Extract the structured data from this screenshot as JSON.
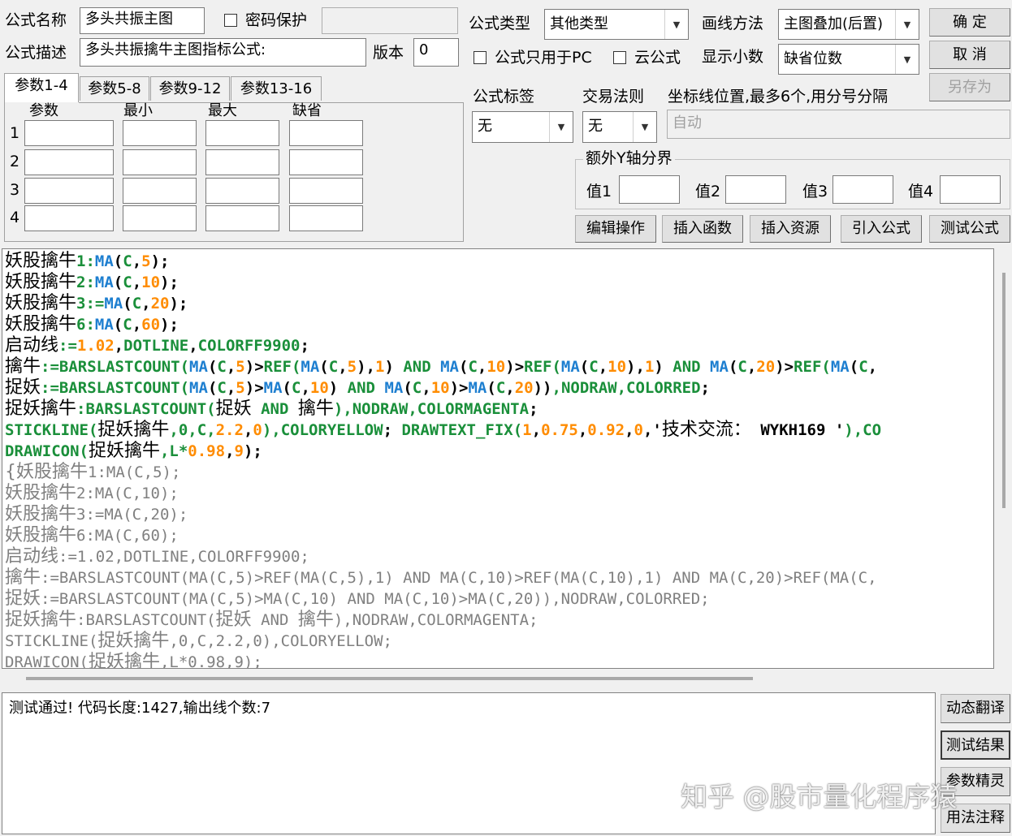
{
  "header": {
    "name_label": "公式名称",
    "name_value": "多头共振主图",
    "password_label": "密码保护",
    "desc_label": "公式描述",
    "desc_value": "多头共振擒牛主图指标公式:",
    "version_label": "版本",
    "version_value": "0",
    "type_label": "公式类型",
    "type_value": "其他类型",
    "draw_label": "画线方法",
    "draw_value": "主图叠加(后置)",
    "pc_only_label": "公式只用于PC",
    "cloud_label": "云公式",
    "decimal_label": "显示小数",
    "decimal_value": "缺省位数"
  },
  "buttons": {
    "ok": "确  定",
    "cancel": "取  消",
    "save_as": "另存为",
    "edit_ops": "编辑操作",
    "insert_func": "插入函数",
    "insert_res": "插入资源",
    "import_formula": "引入公式",
    "test_formula": "测试公式",
    "dyn_translate": "动态翻译",
    "test_result": "测试结果",
    "param_wizard": "参数精灵",
    "usage_note": "用法注释"
  },
  "tabs": [
    "参数1-4",
    "参数5-8",
    "参数9-12",
    "参数13-16"
  ],
  "params": {
    "col_headers": [
      "参数",
      "最小",
      "最大",
      "缺省"
    ],
    "rows": [
      "1",
      "2",
      "3",
      "4"
    ]
  },
  "right_panel": {
    "tag_label": "公式标签",
    "tag_value": "无",
    "rule_label": "交易法则",
    "rule_value": "无",
    "coord_label": "坐标线位置,最多6个,用分号分隔",
    "coord_value": "自动",
    "yaxis_group": "额外Y轴分界",
    "val1": "值1",
    "val2": "值2",
    "val3": "值3",
    "val4": "值4"
  },
  "output": {
    "message": "测试通过! 代码长度:1427,输出线个数:7"
  },
  "watermark": "知乎 @股市量化程序猿",
  "colors": {
    "keyword": "#1a8f3a",
    "function": "#1e7fd0",
    "number": "#ff8c00",
    "comment": "#808080"
  },
  "code_lines": [
    [
      [
        "vn",
        "妖股擒牛"
      ],
      [
        "kw",
        "1:"
      ],
      [
        "fn",
        "MA"
      ],
      [
        "",
        "("
      ],
      [
        "kw",
        "C"
      ],
      [
        "",
        ","
      ],
      [
        "num",
        "5"
      ],
      [
        "",
        ");"
      ]
    ],
    [
      [
        "vn",
        "妖股擒牛"
      ],
      [
        "kw",
        "2:"
      ],
      [
        "fn",
        "MA"
      ],
      [
        "",
        "("
      ],
      [
        "kw",
        "C"
      ],
      [
        "",
        ","
      ],
      [
        "num",
        "10"
      ],
      [
        "",
        ");"
      ]
    ],
    [
      [
        "vn",
        "妖股擒牛"
      ],
      [
        "kw",
        "3:="
      ],
      [
        "fn",
        "MA"
      ],
      [
        "",
        "("
      ],
      [
        "kw",
        "C"
      ],
      [
        "",
        ","
      ],
      [
        "num",
        "20"
      ],
      [
        "",
        ");"
      ]
    ],
    [
      [
        "vn",
        "妖股擒牛"
      ],
      [
        "kw",
        "6:"
      ],
      [
        "fn",
        "MA"
      ],
      [
        "",
        "("
      ],
      [
        "kw",
        "C"
      ],
      [
        "",
        ","
      ],
      [
        "num",
        "60"
      ],
      [
        "",
        ");"
      ]
    ],
    [
      [
        "vn",
        "启动线"
      ],
      [
        "kw",
        ":="
      ],
      [
        "num",
        "1.02"
      ],
      [
        "",
        ","
      ],
      [
        "kw",
        "DOTLINE"
      ],
      [
        "",
        ","
      ],
      [
        "kw",
        "COLORFF9900"
      ],
      [
        "",
        ";"
      ]
    ],
    [
      [
        "vn",
        "擒牛"
      ],
      [
        "kw",
        ":=BARSLASTCOUNT("
      ],
      [
        "fn",
        "MA"
      ],
      [
        "",
        "("
      ],
      [
        "kw",
        "C"
      ],
      [
        "",
        ","
      ],
      [
        "num",
        "5"
      ],
      [
        "",
        ")>"
      ],
      [
        "kw",
        "REF("
      ],
      [
        "fn",
        "MA"
      ],
      [
        "",
        "("
      ],
      [
        "kw",
        "C"
      ],
      [
        "",
        ","
      ],
      [
        "num",
        "5"
      ],
      [
        "",
        "),"
      ],
      [
        "num",
        "1"
      ],
      [
        "",
        ") "
      ],
      [
        "kw",
        "AND "
      ],
      [
        "fn",
        "MA"
      ],
      [
        "",
        "("
      ],
      [
        "kw",
        "C"
      ],
      [
        "",
        ","
      ],
      [
        "num",
        "10"
      ],
      [
        "",
        ")>"
      ],
      [
        "kw",
        "REF("
      ],
      [
        "fn",
        "MA"
      ],
      [
        "",
        "("
      ],
      [
        "kw",
        "C"
      ],
      [
        "",
        ","
      ],
      [
        "num",
        "10"
      ],
      [
        "",
        "),"
      ],
      [
        "num",
        "1"
      ],
      [
        "",
        ") "
      ],
      [
        "kw",
        "AND "
      ],
      [
        "fn",
        "MA"
      ],
      [
        "",
        "("
      ],
      [
        "kw",
        "C"
      ],
      [
        "",
        ","
      ],
      [
        "num",
        "20"
      ],
      [
        "",
        ")>"
      ],
      [
        "kw",
        "REF("
      ],
      [
        "fn",
        "MA"
      ],
      [
        "",
        "("
      ],
      [
        "kw",
        "C"
      ],
      [
        "",
        ","
      ]
    ],
    [
      [
        "vn",
        "捉妖"
      ],
      [
        "kw",
        ":=BARSLASTCOUNT("
      ],
      [
        "fn",
        "MA"
      ],
      [
        "",
        "("
      ],
      [
        "kw",
        "C"
      ],
      [
        "",
        ","
      ],
      [
        "num",
        "5"
      ],
      [
        "",
        ")>"
      ],
      [
        "fn",
        "MA"
      ],
      [
        "",
        "("
      ],
      [
        "kw",
        "C"
      ],
      [
        "",
        ","
      ],
      [
        "num",
        "10"
      ],
      [
        "",
        ") "
      ],
      [
        "kw",
        "AND "
      ],
      [
        "fn",
        "MA"
      ],
      [
        "",
        "("
      ],
      [
        "kw",
        "C"
      ],
      [
        "",
        ","
      ],
      [
        "num",
        "10"
      ],
      [
        "",
        ")>"
      ],
      [
        "fn",
        "MA"
      ],
      [
        "",
        "("
      ],
      [
        "kw",
        "C"
      ],
      [
        "",
        ","
      ],
      [
        "num",
        "20"
      ],
      [
        "",
        "))"
      ],
      [
        "kw",
        ",NODRAW,COLORRED"
      ],
      [
        "",
        ";"
      ]
    ],
    [
      [
        "vn",
        "捉妖擒牛"
      ],
      [
        "kw",
        ":BARSLASTCOUNT("
      ],
      [
        "vn",
        "捉妖"
      ],
      [
        "kw",
        " AND "
      ],
      [
        "vn",
        "擒牛"
      ],
      [
        "kw",
        "),NODRAW,COLORMAGENTA"
      ],
      [
        "",
        ";"
      ]
    ],
    [
      [
        "kw",
        "STICKLINE("
      ],
      [
        "vn",
        "捉妖擒牛"
      ],
      [
        "kw",
        ",0,C,"
      ],
      [
        "num",
        "2.2"
      ],
      [
        "",
        ","
      ],
      [
        "num",
        "0"
      ],
      [
        "kw",
        "),COLORYELLOW"
      ],
      [
        "",
        "; "
      ],
      [
        "kw",
        "DRAWTEXT_FIX("
      ],
      [
        "num",
        "1"
      ],
      [
        "",
        ","
      ],
      [
        "num",
        "0.75"
      ],
      [
        "",
        ","
      ],
      [
        "num",
        "0.92"
      ],
      [
        "",
        ","
      ],
      [
        "num",
        "0"
      ],
      [
        "",
        ",'"
      ],
      [
        "vn",
        "技术交流："
      ],
      [
        "",
        " WYKH169 '"
      ],
      [
        "kw",
        "),CO"
      ]
    ],
    [
      [
        "kw",
        "DRAWICON("
      ],
      [
        "vn",
        "捉妖擒牛"
      ],
      [
        "kw",
        ",L*"
      ],
      [
        "num",
        "0.98"
      ],
      [
        "",
        ","
      ],
      [
        "num",
        "9"
      ],
      [
        "",
        ");"
      ]
    ],
    [
      [
        "cmvn",
        "{妖股擒牛"
      ],
      [
        "cm",
        "1:MA(C,5);"
      ]
    ],
    [
      [
        "cmvn",
        "妖股擒牛"
      ],
      [
        "cm",
        "2:MA(C,10);"
      ]
    ],
    [
      [
        "cmvn",
        "妖股擒牛"
      ],
      [
        "cm",
        "3:=MA(C,20);"
      ]
    ],
    [
      [
        "cmvn",
        "妖股擒牛"
      ],
      [
        "cm",
        "6:MA(C,60);"
      ]
    ],
    [
      [
        "cmvn",
        "启动线"
      ],
      [
        "cm",
        ":=1.02,DOTLINE,COLORFF9900;"
      ]
    ],
    [
      [
        "cmvn",
        "擒牛"
      ],
      [
        "cm",
        ":=BARSLASTCOUNT(MA(C,5)>REF(MA(C,5),1) AND MA(C,10)>REF(MA(C,10),1) AND MA(C,20)>REF(MA(C,"
      ]
    ],
    [
      [
        "cmvn",
        "捉妖"
      ],
      [
        "cm",
        ":=BARSLASTCOUNT(MA(C,5)>MA(C,10) AND MA(C,10)>MA(C,20)),NODRAW,COLORRED;"
      ]
    ],
    [
      [
        "cmvn",
        "捉妖擒牛"
      ],
      [
        "cm",
        ":BARSLASTCOUNT("
      ],
      [
        "cmvn",
        "捉妖"
      ],
      [
        "cm",
        " AND "
      ],
      [
        "cmvn",
        "擒牛"
      ],
      [
        "cm",
        "),NODRAW,COLORMAGENTA;"
      ]
    ],
    [
      [
        "cm",
        "STICKLINE("
      ],
      [
        "cmvn",
        "捉妖擒牛"
      ],
      [
        "cm",
        ",0,C,2.2,0),COLORYELLOW;"
      ]
    ],
    [
      [
        "cm",
        "DRAWICON("
      ],
      [
        "cmvn",
        "捉妖擒牛"
      ],
      [
        "cm",
        ",L*0.98,9);"
      ]
    ]
  ]
}
